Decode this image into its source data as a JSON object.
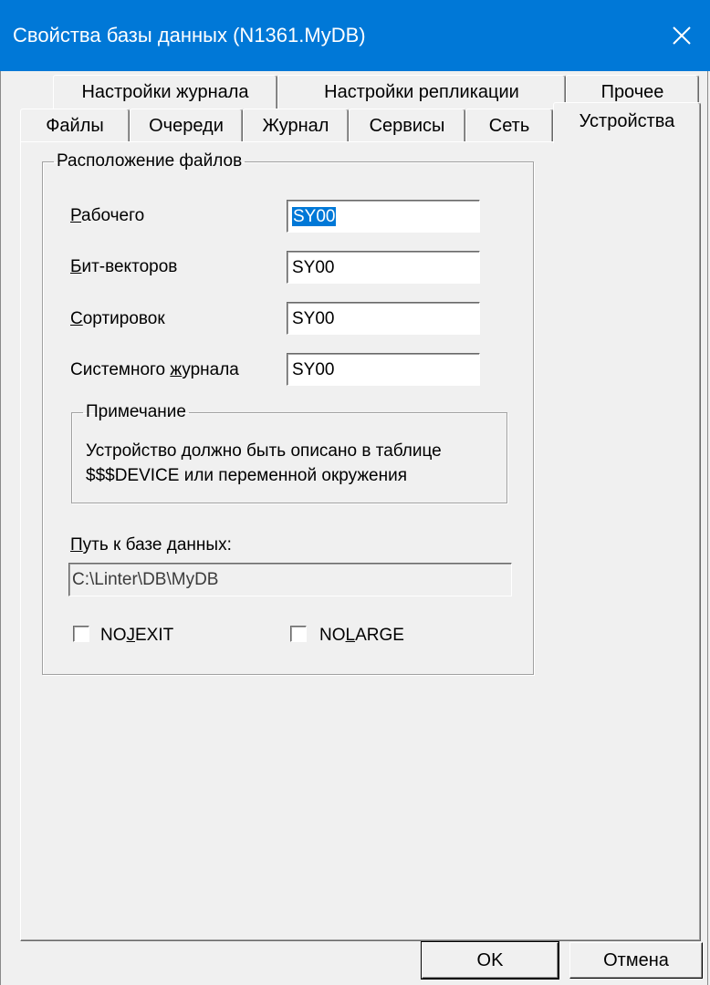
{
  "window": {
    "title": "Свойства базы данных (N1361.MyDB)"
  },
  "tabs": {
    "row_top": [
      "Настройки журнала",
      "Настройки репликации",
      "Прочее"
    ],
    "row_bottom": [
      "Файлы",
      "Очереди",
      "Журнал",
      "Сервисы",
      "Сеть",
      "Устройства"
    ],
    "active": "Устройства"
  },
  "file_locations": {
    "legend": "Расположение файлов",
    "fields": [
      {
        "label_hot": "Р",
        "label_rest": "абочего",
        "value": "SY00",
        "selected": true
      },
      {
        "label_hot": "Б",
        "label_rest": "ит-векторов",
        "value": "SY00",
        "selected": false
      },
      {
        "label_hot": "С",
        "label_rest": "ортировок",
        "value": "SY00",
        "selected": false
      },
      {
        "label_pre": "Системного ",
        "label_hot": "ж",
        "label_rest": "урнала",
        "value": "SY00",
        "selected": false
      }
    ]
  },
  "note": {
    "legend": "Примечание",
    "line1": "Устройство должно быть описано в таблице",
    "line2": "$$$DEVICE или переменной окружения"
  },
  "db_path": {
    "label_hot": "П",
    "label_rest": "уть к базе данных:",
    "value": "C:\\Linter\\DB\\MyDB"
  },
  "checkboxes": [
    {
      "pre": "NO",
      "hot": "J",
      "rest": "EXIT",
      "checked": false
    },
    {
      "pre": "NO",
      "hot": "L",
      "rest": "ARGE",
      "checked": false
    }
  ],
  "buttons": {
    "ok": "OK",
    "cancel": "Отмена"
  },
  "colors": {
    "titlebar": "#0078d7",
    "selection": "#0078d7",
    "dialog_bg": "#f0f0f0"
  }
}
